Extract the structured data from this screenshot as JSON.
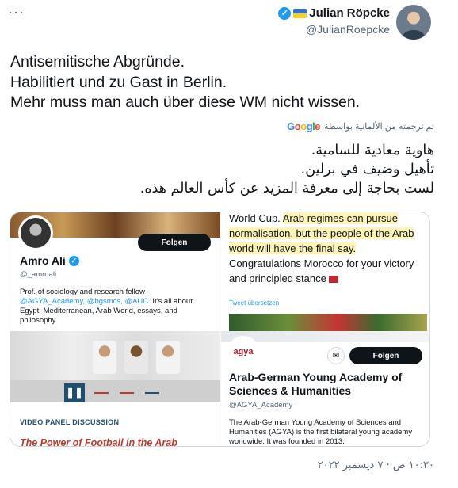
{
  "header": {
    "more_label": "···",
    "author_name": "Julian Röpcke",
    "author_handle": "@JulianRoepcke"
  },
  "tweet": {
    "lines": [
      "Antisemitische Abgründe.",
      "Habilitiert und zu Gast in Berlin.",
      "Mehr muss man auch über diese WM nicht wissen."
    ]
  },
  "translation": {
    "note": "تم ترجمته من الألمانية بواسطة",
    "provider": "Google",
    "lines": [
      "هاوية معادية للسامية.",
      "تأهيل وضيف في برلين.",
      "لست بحاجة إلى معرفة المزيد عن كأس العالم هذه."
    ]
  },
  "media": {
    "amro": {
      "follow_label": "Folgen",
      "name": "Amro Ali",
      "handle": "@_amroali",
      "bio_start": "Prof. of sociology and research fellow - ",
      "bio_links": "@AGYA_Academy, @bgsmcs, @AUC",
      "bio_end": ". It's all about Egypt, Mediterranean, Arab World, essays, and philosophy."
    },
    "worldcup": {
      "plain1": "World Cup. ",
      "highlight": "Arab regimes can pursue normalisation, but the people of the Arab world will have the final say.",
      "plain2": " Congratulations Morocco for your victory and principled stance",
      "translate_label": "Tweet übersetzen"
    },
    "video": {
      "pause_icon": "❚❚",
      "category": "VIDEO PANEL DISCUSSION",
      "title": "The Power of Football in the Arab"
    },
    "agya": {
      "logo_text": "agya",
      "mail_icon": "✉",
      "follow_label": "Folgen",
      "name": "Arab-German Young Academy of Sciences & Humanities",
      "handle": "@AGYA_Academy",
      "bio": "The Arab-German Young Academy of Sciences and Humanities (AGYA) is the first bilateral young academy worldwide. It was founded in 2013."
    }
  },
  "timestamp": "١٠:٣٠ ص · ٧ ديسمبر ٢٠٢٢"
}
